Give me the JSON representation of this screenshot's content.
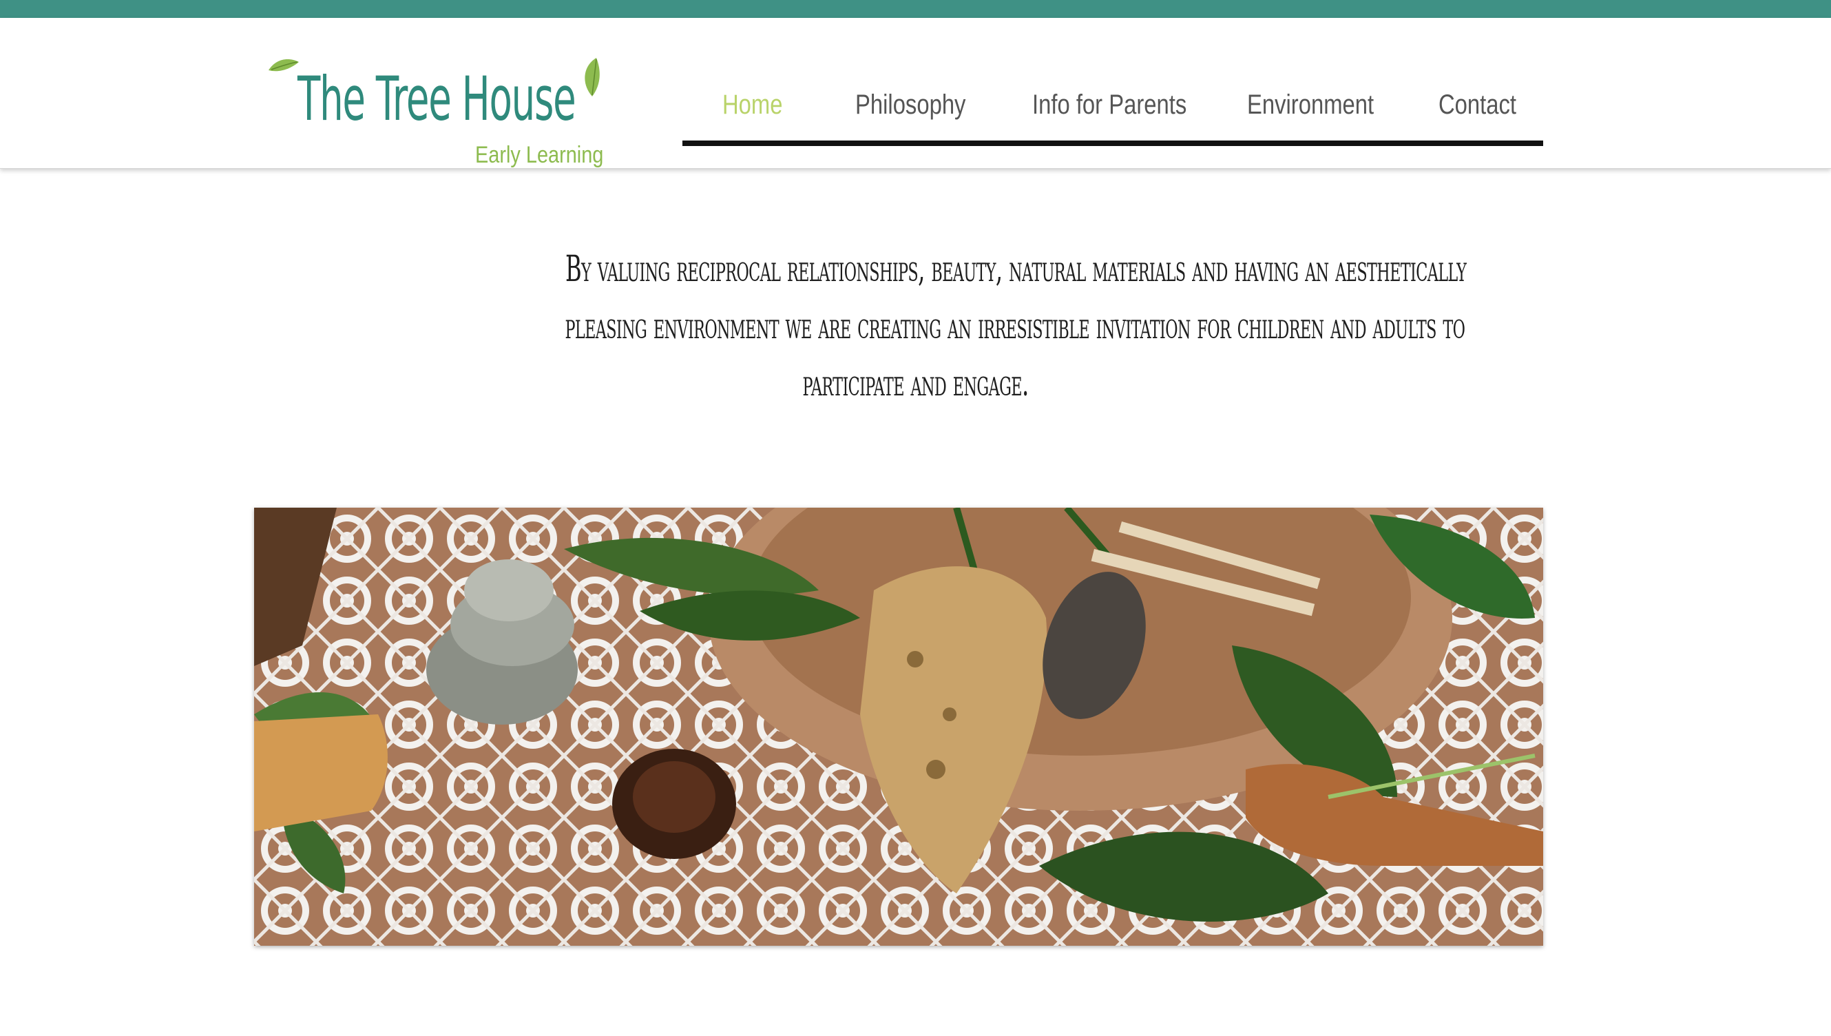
{
  "brand": {
    "name": "The Tree House",
    "subtitle": "Early Learning",
    "accent": "#3f9185",
    "leaf_color": "#8dbb4f"
  },
  "nav": {
    "items": [
      {
        "label": "Home",
        "active": true
      },
      {
        "label": "Philosophy",
        "active": false
      },
      {
        "label": "Info for Parents",
        "active": false
      },
      {
        "label": "Environment",
        "active": false
      },
      {
        "label": "Contact",
        "active": false
      }
    ],
    "active_color": "#b9d36a"
  },
  "main": {
    "tagline_lines": [
      "By valuing reciprocal relationships, beauty, natural materials and having an aesthetically",
      "pleasing environment we are creating an irresistible invitation for children and adults to",
      "participate and engage."
    ]
  },
  "hero": {
    "image_icon": "nature-table-photo"
  }
}
